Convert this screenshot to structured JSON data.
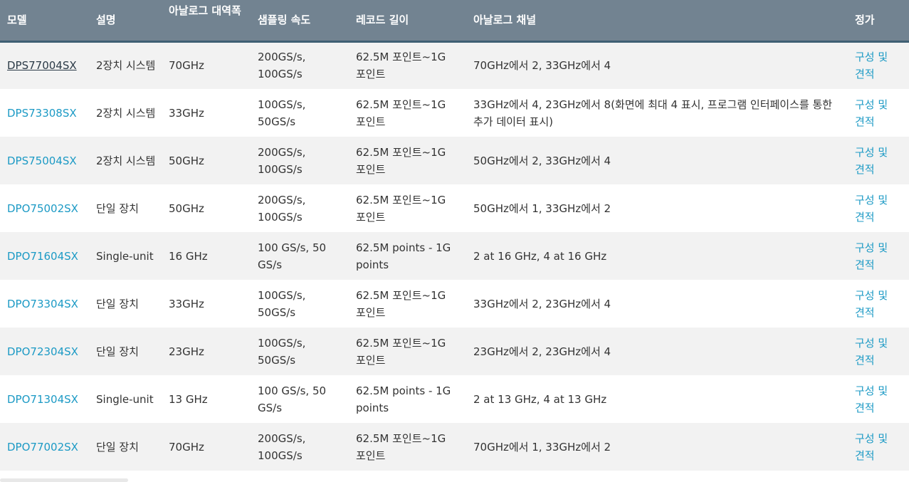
{
  "table": {
    "headers": [
      "모델",
      "설명",
      "아날로그 대역폭",
      "샘플링 속도",
      "레코드 길이",
      "아날로그 채널",
      "정가"
    ],
    "rows": [
      {
        "model": "DPS77004SX",
        "active": true,
        "desc": "2장치 시스템",
        "bandwidth": "70GHz",
        "sampling": "200GS/s, 100GS/s",
        "record": "62.5M 포인트~1G 포인트",
        "channels": "70GHz에서 2, 33GHz에서 4",
        "price": "구성 및 견적"
      },
      {
        "model": "DPS73308SX",
        "active": false,
        "desc": "2장치 시스템",
        "bandwidth": "33GHz",
        "sampling": "100GS/s, 50GS/s",
        "record": "62.5M 포인트~1G 포인트",
        "channels": "33GHz에서 4, 23GHz에서 8(화면에 최대 4 표시, 프로그램 인터페이스를 통한 추가 데이터 표시)",
        "price": "구성 및 견적"
      },
      {
        "model": "DPS75004SX",
        "active": false,
        "desc": "2장치 시스템",
        "bandwidth": "50GHz",
        "sampling": "200GS/s, 100GS/s",
        "record": "62.5M 포인트~1G 포인트",
        "channels": "50GHz에서 2, 33GHz에서 4",
        "price": "구성 및 견적"
      },
      {
        "model": "DPO75002SX",
        "active": false,
        "desc": "단일 장치",
        "bandwidth": "50GHz",
        "sampling": "200GS/s, 100GS/s",
        "record": "62.5M 포인트~1G 포인트",
        "channels": "50GHz에서 1, 33GHz에서 2",
        "price": "구성 및 견적"
      },
      {
        "model": "DPO71604SX",
        "active": false,
        "desc": "Single-unit",
        "bandwidth": "16 GHz",
        "sampling": "100 GS/s, 50 GS/s",
        "record": "62.5M points - 1G points",
        "channels": "2 at 16 GHz, 4 at 16 GHz",
        "price": "구성 및 견적"
      },
      {
        "model": "DPO73304SX",
        "active": false,
        "desc": "단일 장치",
        "bandwidth": "33GHz",
        "sampling": "100GS/s, 50GS/s",
        "record": "62.5M 포인트~1G 포인트",
        "channels": "33GHz에서 2, 23GHz에서 4",
        "price": "구성 및 견적"
      },
      {
        "model": "DPO72304SX",
        "active": false,
        "desc": "단일 장치",
        "bandwidth": "23GHz",
        "sampling": "100GS/s, 50GS/s",
        "record": "62.5M 포인트~1G 포인트",
        "channels": "23GHz에서 2, 23GHz에서 4",
        "price": "구성 및 견적"
      },
      {
        "model": "DPO71304SX",
        "active": false,
        "desc": "Single-unit",
        "bandwidth": "13 GHz",
        "sampling": "100 GS/s, 50 GS/s",
        "record": "62.5M points - 1G points",
        "channels": "2 at 13 GHz, 4 at 13 GHz",
        "price": "구성 및 견적"
      },
      {
        "model": "DPO77002SX",
        "active": false,
        "desc": "단일 장치",
        "bandwidth": "70GHz",
        "sampling": "200GS/s, 100GS/s",
        "record": "62.5M 포인트~1G 포인트",
        "channels": "70GHz에서 1, 33GHz에서 2",
        "price": "구성 및 견적"
      }
    ]
  }
}
